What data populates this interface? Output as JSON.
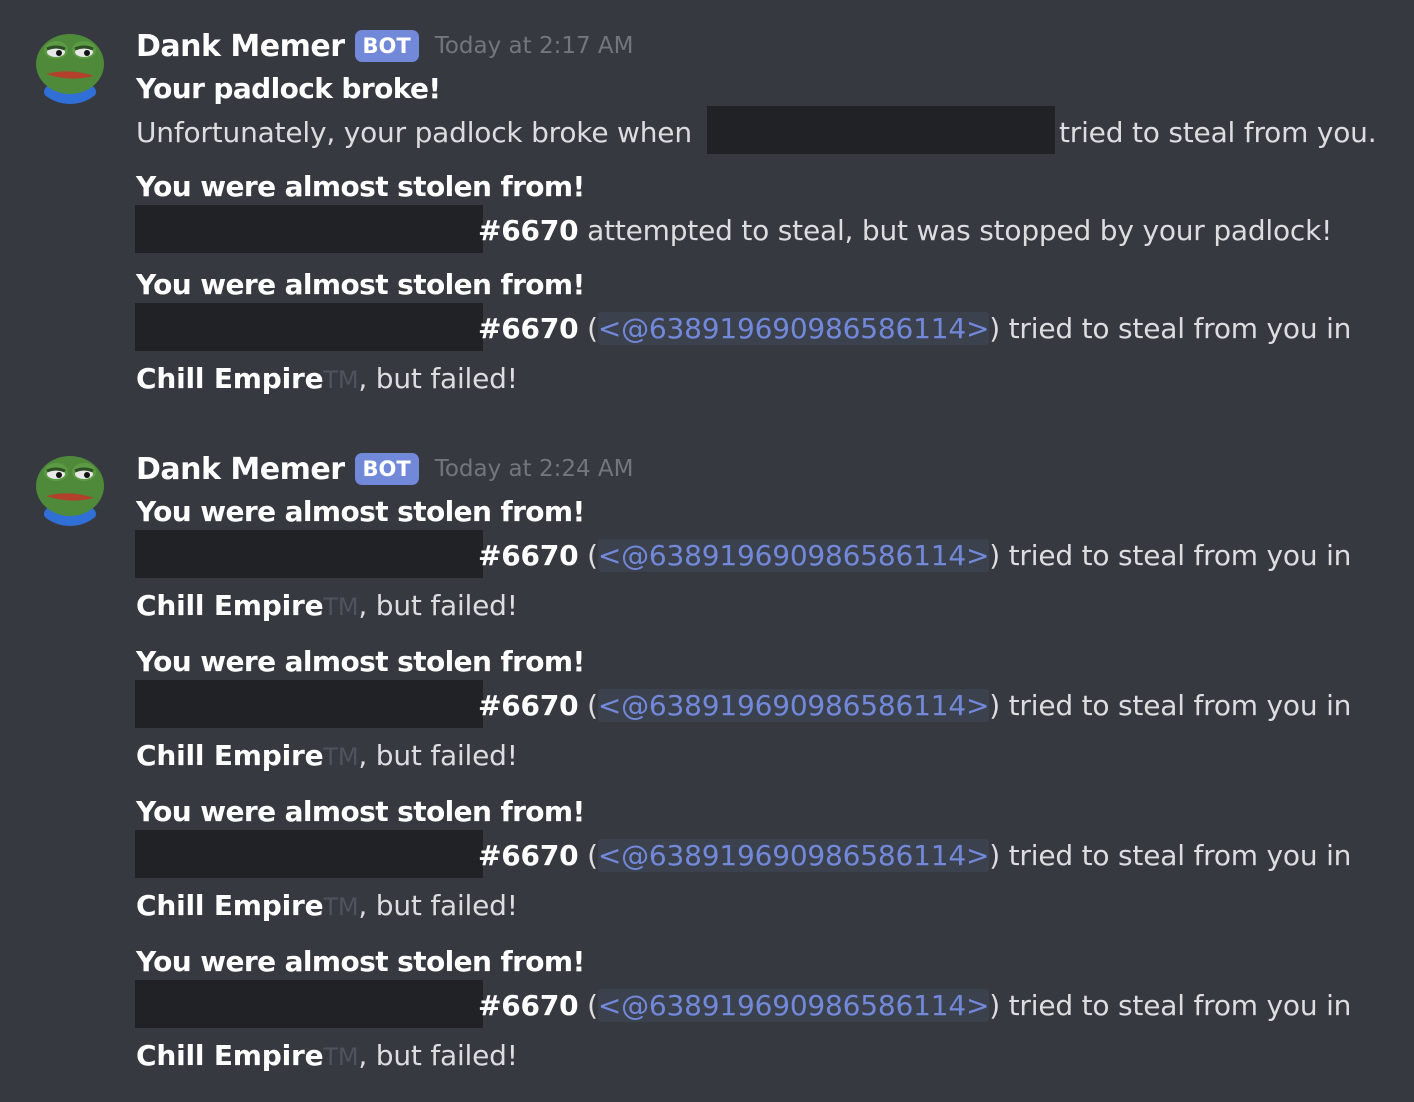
{
  "messages": [
    {
      "username": "Dank Memer",
      "bot_tag": "BOT",
      "timestamp": "Today at 2:17 AM",
      "avatar_icon": "pepe-frog-avatar",
      "padlock": {
        "title": "Your padlock broke!",
        "text_before": "Unfortunately, your padlock broke when",
        "text_after": "tried to steal from you."
      },
      "almost_stopped": {
        "title": "You were almost stolen from!",
        "tag": "#6670",
        "text": "attempted to steal, but was stopped by your padlock!"
      },
      "almost_failed": {
        "title": "You were almost stolen from!",
        "tag": "#6670",
        "open_paren": "(",
        "mention": "<@638919690986586114>",
        "text": ") tried to steal from you in",
        "server": "Chill Empire",
        "tm": "TM",
        "ending": ", but failed!"
      }
    },
    {
      "username": "Dank Memer",
      "bot_tag": "BOT",
      "timestamp": "Today at 2:24 AM",
      "avatar_icon": "pepe-frog-avatar",
      "entries": [
        {
          "title": "You were almost stolen from!",
          "tag": "#6670",
          "open_paren": "(",
          "mention": "<@638919690986586114>",
          "text": ") tried to steal from you in",
          "server": "Chill Empire",
          "tm": "TM",
          "ending": ", but failed!"
        },
        {
          "title": "You were almost stolen from!",
          "tag": "#6670",
          "open_paren": "(",
          "mention": "<@638919690986586114>",
          "text": ") tried to steal from you in",
          "server": "Chill Empire",
          "tm": "TM",
          "ending": ", but failed!"
        },
        {
          "title": "You were almost stolen from!",
          "tag": "#6670",
          "open_paren": "(",
          "mention": "<@638919690986586114>",
          "text": ") tried to steal from you in",
          "server": "Chill Empire",
          "tm": "TM",
          "ending": ", but failed!"
        },
        {
          "title": "You were almost stolen from!",
          "tag": "#6670",
          "open_paren": "(",
          "mention": "<@638919690986586114>",
          "text": ") tried to steal from you in",
          "server": "Chill Empire",
          "tm": "TM",
          "ending": ", but failed!"
        }
      ]
    }
  ],
  "colors": {
    "background": "#36393f",
    "redaction": "#202225",
    "bot_tag": "#7289da",
    "mention": "#7289da",
    "timestamp": "#72767d"
  }
}
